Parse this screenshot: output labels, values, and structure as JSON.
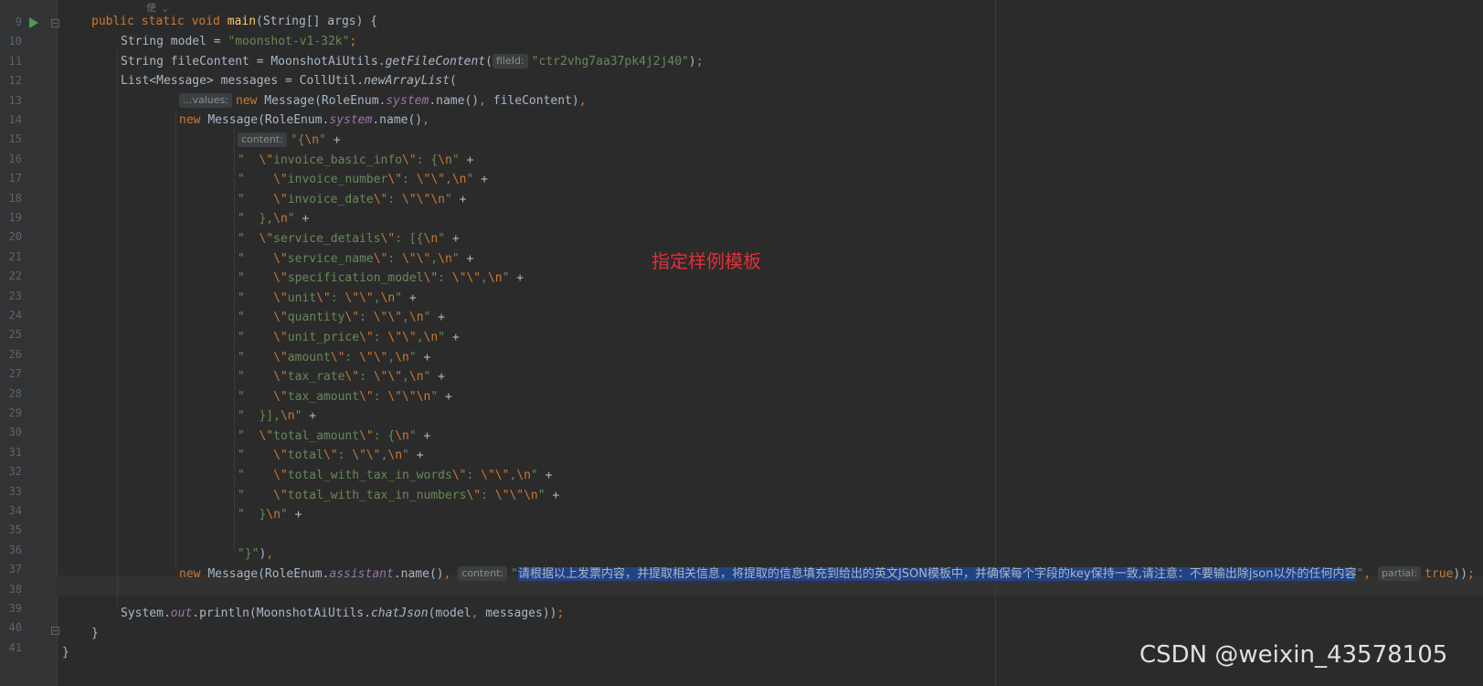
{
  "line_numbers": [
    "9",
    "10",
    "11",
    "12",
    "13",
    "14",
    "15",
    "16",
    "17",
    "18",
    "19",
    "20",
    "21",
    "22",
    "23",
    "24",
    "25",
    "26",
    "27",
    "28",
    "29",
    "30",
    "31",
    "32",
    "33",
    "34",
    "35",
    "36",
    "37",
    "38",
    "39",
    "40",
    "41"
  ],
  "code": {
    "override_hint": "使 ⌄",
    "model_str": "\"moonshot-v1-32k\"",
    "fileid_hint": "fileId:",
    "fileid_str": "\"ctr2vhg7aa37pk4j2j40\"",
    "values_hint": "...values:",
    "content_hint": "content:",
    "partial_hint": "partial:",
    "assistant_str_cn": "请根据以上发票内容，并提取相关信息，将提取的信息填充到给出的英文JSON模板中，并确保每个字段的key保持一致,请注意：不要输出除json以外的任何内容"
  },
  "annotation": "指定样例模板",
  "watermark": "CSDN @weixin_43578105",
  "colors": {
    "background": "#2b2b2b",
    "keyword": "#cc7832",
    "string": "#6a8759",
    "method": "#ffc66d",
    "static_field": "#9876aa",
    "selection": "#214283",
    "annotation": "#e0303a"
  }
}
